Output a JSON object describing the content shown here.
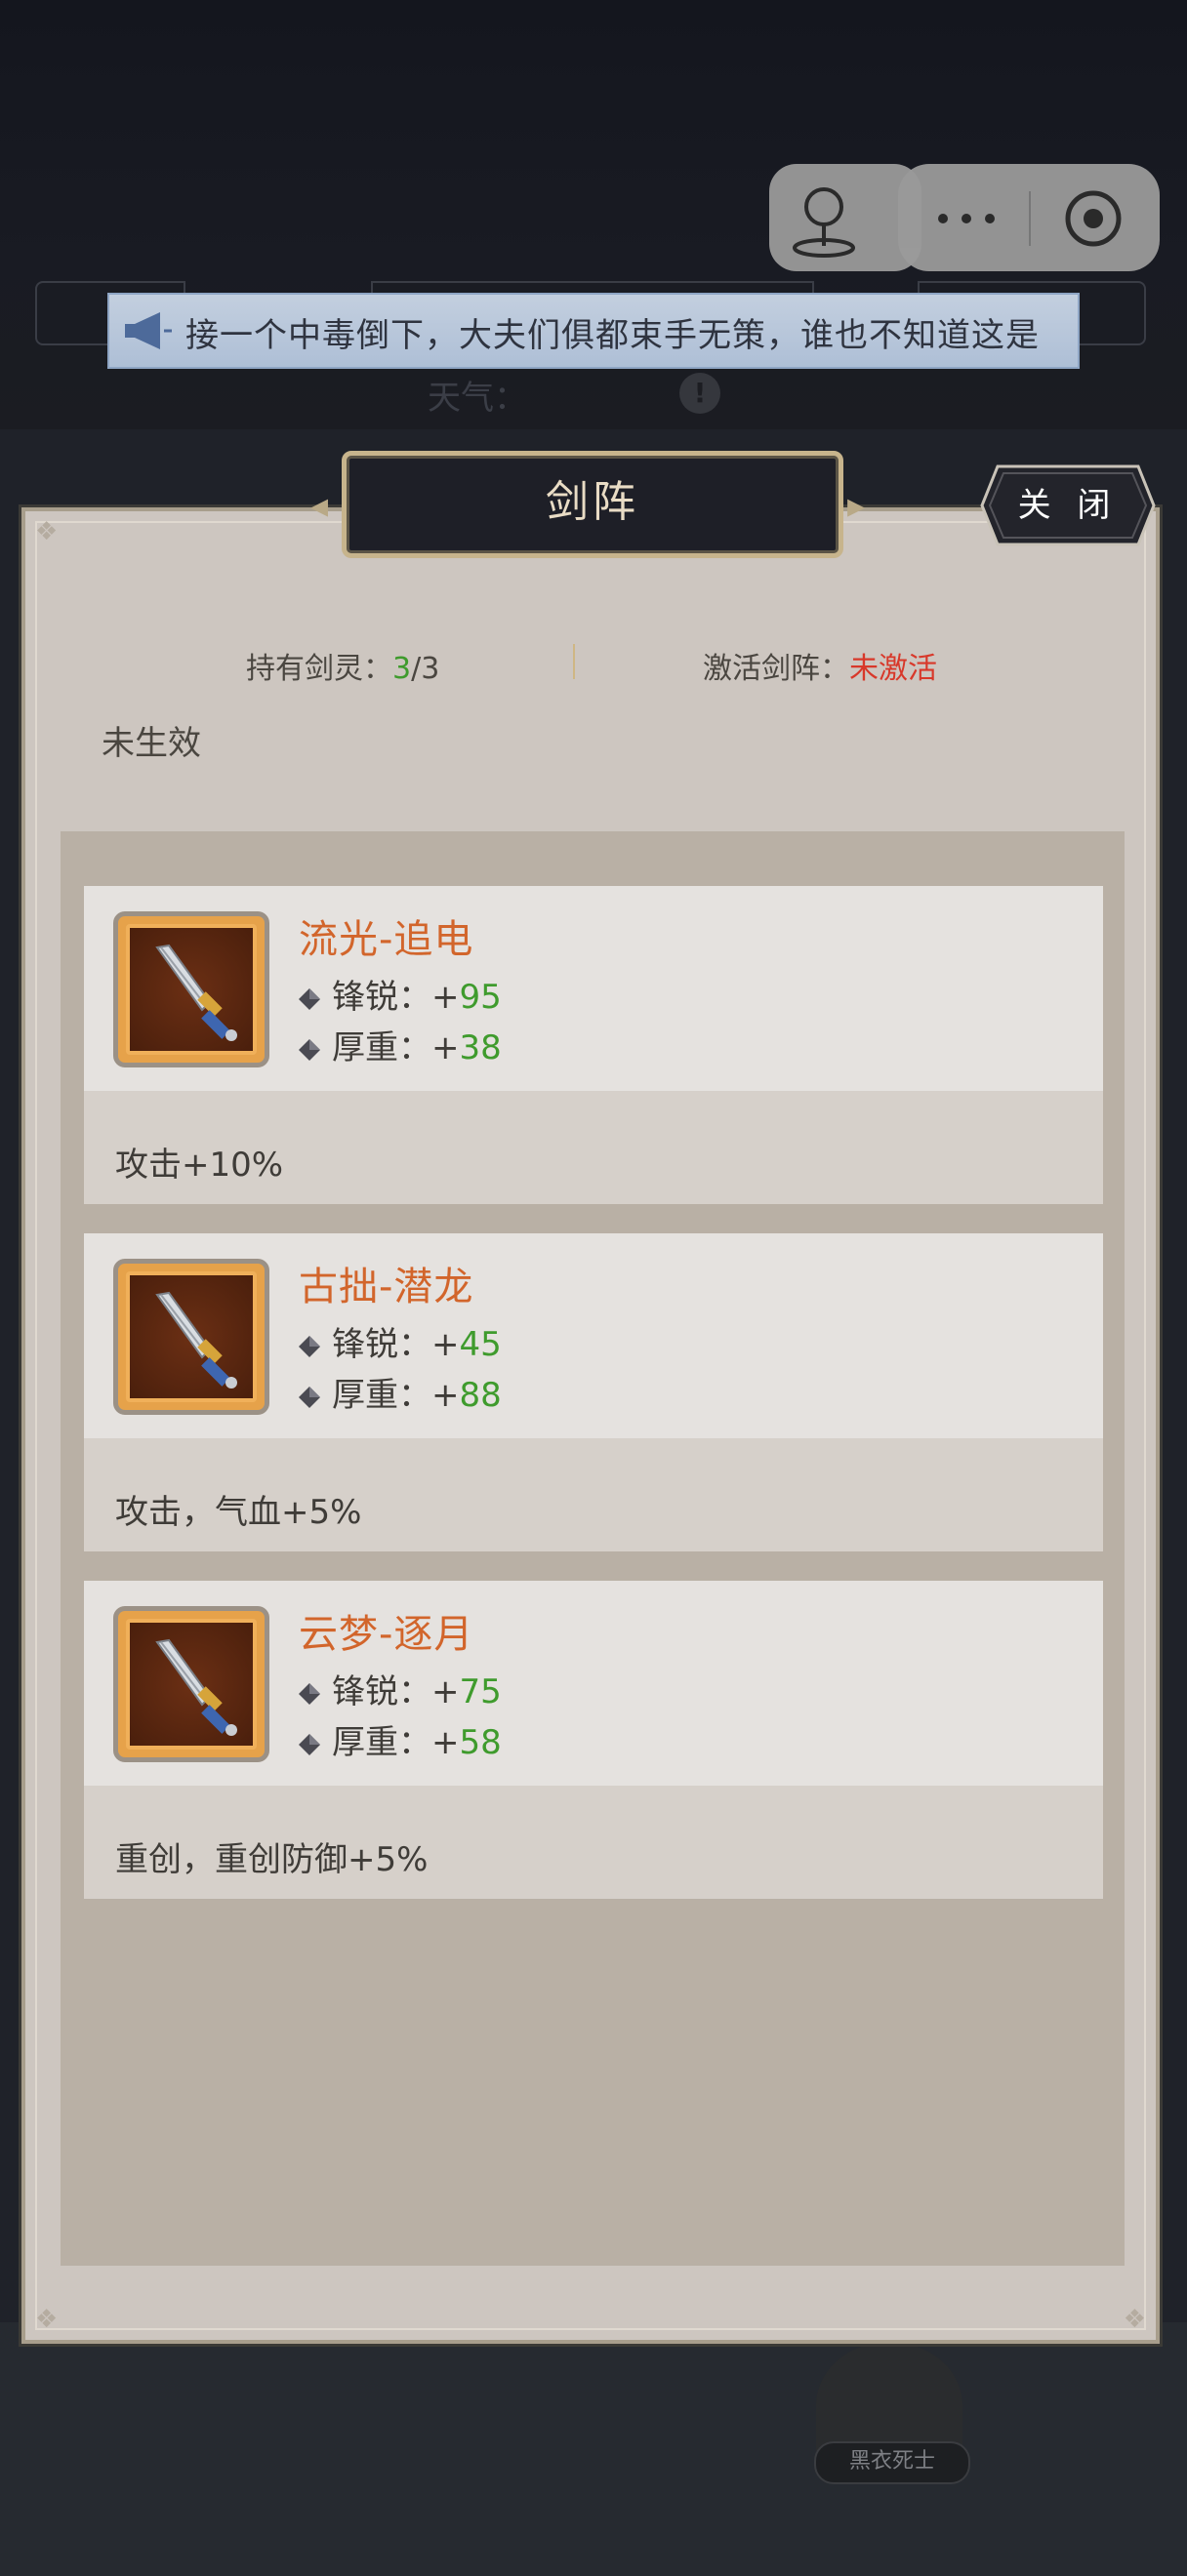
{
  "notice": {
    "text": "接一个中毒倒下，大夫们俱都束手无策，谁也不知道这是"
  },
  "hud": {
    "weather_label": "天气："
  },
  "panel": {
    "title": "剑阵",
    "close_label": "关 闭",
    "held_label": "持有剑灵：",
    "held_current": "3",
    "held_total": "/3",
    "activate_label": "激活剑阵：",
    "activate_status": "未激活",
    "effect_status": "未生效"
  },
  "cards": [
    {
      "name": "流光-追电",
      "attr1_label": "锋锐：",
      "attr1_sign": "+",
      "attr1_value": "95",
      "attr2_label": "厚重：",
      "attr2_sign": "+",
      "attr2_value": "38",
      "desc": "攻击+10%"
    },
    {
      "name": "古拙-潜龙",
      "attr1_label": "锋锐：",
      "attr1_sign": "+",
      "attr1_value": "45",
      "attr2_label": "厚重：",
      "attr2_sign": "+",
      "attr2_value": "88",
      "desc": "攻击，气血+5%"
    },
    {
      "name": "云梦-逐月",
      "attr1_label": "锋锐：",
      "attr1_sign": "+",
      "attr1_value": "75",
      "attr2_label": "厚重：",
      "attr2_sign": "+",
      "attr2_value": "58",
      "desc": "重创，重创防御+5%"
    }
  ],
  "npc": {
    "label": "黑衣死士"
  },
  "colors": {
    "accent_name": "#d2652b",
    "positive": "#3f9b2d",
    "inactive": "#d8382a"
  }
}
